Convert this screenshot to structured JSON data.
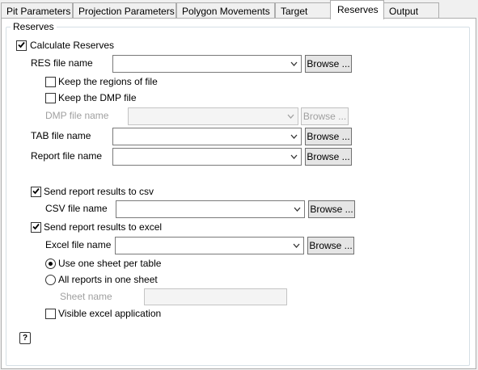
{
  "tabs": [
    {
      "label": "Pit Parameters"
    },
    {
      "label": "Projection Parameters"
    },
    {
      "label": "Polygon Movements"
    },
    {
      "label": "Target"
    },
    {
      "label": "Reserves"
    },
    {
      "label": "Output"
    }
  ],
  "active_tab": "Reserves",
  "group_title": "Reserves",
  "calculate_reserves": {
    "label": "Calculate Reserves",
    "checked": true
  },
  "res_file": {
    "label": "RES file name",
    "value": "",
    "browse": "Browse ..."
  },
  "keep_regions": {
    "label": "Keep the regions of file",
    "checked": false
  },
  "keep_dmp": {
    "label": "Keep the DMP file",
    "checked": false
  },
  "dmp_file": {
    "label": "DMP file name",
    "value": "",
    "browse": "Browse ...",
    "enabled": false
  },
  "tab_file": {
    "label": "TAB file name",
    "value": "",
    "browse": "Browse ..."
  },
  "report_file": {
    "label": "Report file name",
    "value": "",
    "browse": "Browse ..."
  },
  "send_csv": {
    "label": "Send report results to csv",
    "checked": true
  },
  "csv_file": {
    "label": "CSV file name",
    "value": "",
    "browse": "Browse ..."
  },
  "send_excel": {
    "label": "Send report results to excel",
    "checked": true
  },
  "excel_file": {
    "label": "Excel file name",
    "value": "",
    "browse": "Browse ..."
  },
  "sheet_mode": {
    "one_per_table": {
      "label": "Use one sheet per table",
      "selected": true
    },
    "all_in_one": {
      "label": "All reports in one sheet",
      "selected": false
    }
  },
  "sheet_name": {
    "label": "Sheet name",
    "value": "",
    "enabled": false
  },
  "visible_excel": {
    "label": "Visible excel application",
    "checked": false
  },
  "help_icon": "help-icon"
}
